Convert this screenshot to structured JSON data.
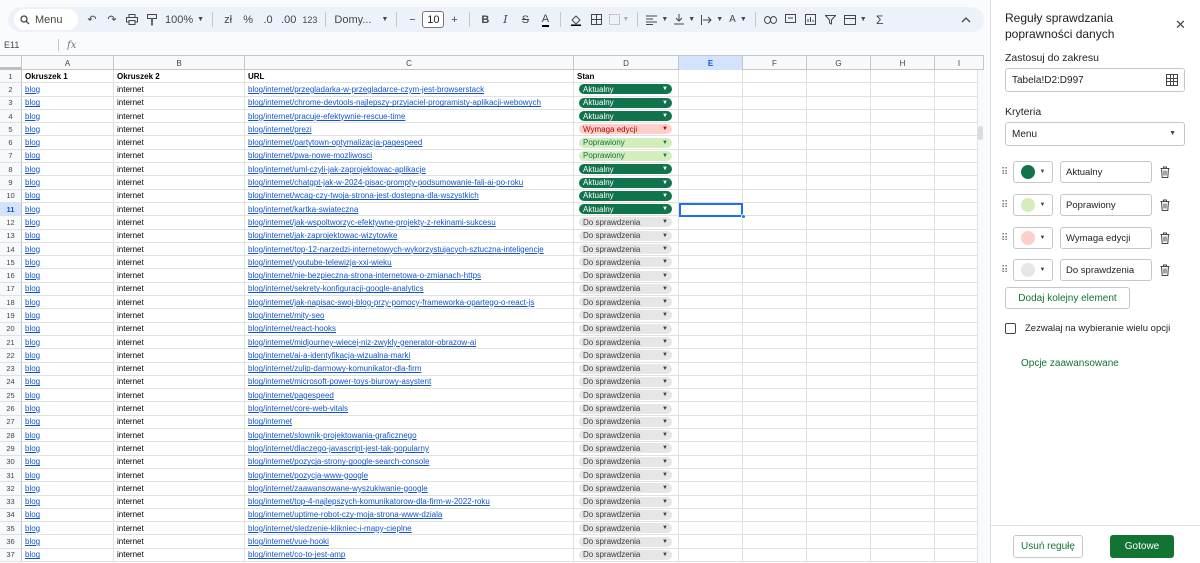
{
  "toolbar": {
    "search_label": "Menu",
    "zoom": "100%",
    "currency": "zł",
    "percent": "%",
    "dec_decrease": ".0",
    "dec_increase": ".00",
    "number_format": "123",
    "font": "Domy...",
    "font_size": "10",
    "minus": "−",
    "plus": "+"
  },
  "formula_bar": {
    "name_box": "E11",
    "fx": "fx",
    "value": ""
  },
  "columns": [
    "A",
    "B",
    "C",
    "D",
    "E",
    "F",
    "G",
    "H",
    "I"
  ],
  "header_row": {
    "a": "Okruszek 1",
    "b": "Okruszek 2",
    "c": "URL",
    "d": "Stan"
  },
  "status_colors": {
    "Aktualny": {
      "bg": "#11734b",
      "fg": "#ffffff"
    },
    "Poprawiony": {
      "bg": "#d4edbc",
      "fg": "#11734b"
    },
    "Wymaga edycji": {
      "bg": "#ffcfc9",
      "fg": "#b10202"
    },
    "Do sprawdzenia": {
      "bg": "#e6e6e6",
      "fg": "#3d3d3d"
    }
  },
  "rows": [
    {
      "num": "2",
      "a": "blog",
      "b": "internet",
      "c": "blog/internet/przegladarka-w-przegladarce-czym-jest-browserstack",
      "d": "Aktualny"
    },
    {
      "num": "3",
      "a": "blog",
      "b": "internet",
      "c": "blog/internet/chrome-devtools-najlepszy-przyjaciel-programisty-aplikacji-webowych",
      "d": "Aktualny"
    },
    {
      "num": "4",
      "a": "blog",
      "b": "internet",
      "c": "blog/internet/pracuje-efektywnie-rescue-time",
      "d": "Aktualny"
    },
    {
      "num": "5",
      "a": "blog",
      "b": "internet",
      "c": "blog/internet/prezi",
      "d": "Wymaga edycji"
    },
    {
      "num": "6",
      "a": "blog",
      "b": "internet",
      "c": "blog/internet/partytown-optymalizacja-pagespeed",
      "d": "Poprawiony"
    },
    {
      "num": "7",
      "a": "blog",
      "b": "internet",
      "c": "blog/internet/pwa-nowe-mozliwosci",
      "d": "Poprawiony"
    },
    {
      "num": "8",
      "a": "blog",
      "b": "internet",
      "c": "blog/internet/uml-czyli-jak-zaprojektowac-aplikacje",
      "d": "Aktualny"
    },
    {
      "num": "9",
      "a": "blog",
      "b": "internet",
      "c": "blog/internet/chatgpt-jak-w-2024-pisac-prompty-podsumowanie-fali-ai-po-roku",
      "d": "Aktualny"
    },
    {
      "num": "10",
      "a": "blog",
      "b": "internet",
      "c": "blog/internet/wcag-czy-twoja-strona-jest-dostepna-dla-wszystkich",
      "d": "Aktualny"
    },
    {
      "num": "11",
      "a": "blog",
      "b": "internet",
      "c": "blog/internet/kartka-swiateczna",
      "d": "Aktualny"
    },
    {
      "num": "12",
      "a": "blog",
      "b": "internet",
      "c": "blog/internet/jak-wspoltworzyc-efektywne-projekty-z-rekinami-sukcesu",
      "d": "Do sprawdzenia"
    },
    {
      "num": "13",
      "a": "blog",
      "b": "internet",
      "c": "blog/internet/jak-zaprojektowac-wizytowke",
      "d": "Do sprawdzenia"
    },
    {
      "num": "14",
      "a": "blog",
      "b": "internet",
      "c": "blog/internet/top-12-narzedzi-internetowych-wykorzystujacych-sztuczna-inteligencje",
      "d": "Do sprawdzenia"
    },
    {
      "num": "15",
      "a": "blog",
      "b": "internet",
      "c": "blog/internet/youtube-telewizja-xxi-wieku",
      "d": "Do sprawdzenia"
    },
    {
      "num": "16",
      "a": "blog",
      "b": "internet",
      "c": "blog/internet/nie-bezpieczna-strona-internetowa-o-zmianach-https",
      "d": "Do sprawdzenia"
    },
    {
      "num": "17",
      "a": "blog",
      "b": "internet",
      "c": "blog/internet/sekrety-konfiguracji-google-analytics",
      "d": "Do sprawdzenia"
    },
    {
      "num": "18",
      "a": "blog",
      "b": "internet",
      "c": "blog/internet/jak-napisac-swoj-blog-przy-pomocy-frameworka-opartego-o-react-js",
      "d": "Do sprawdzenia"
    },
    {
      "num": "19",
      "a": "blog",
      "b": "internet",
      "c": "blog/internet/mity-seo",
      "d": "Do sprawdzenia"
    },
    {
      "num": "20",
      "a": "blog",
      "b": "internet",
      "c": "blog/internet/react-hooks",
      "d": "Do sprawdzenia"
    },
    {
      "num": "21",
      "a": "blog",
      "b": "internet",
      "c": "blog/internet/midjourney-wiecej-niz-zwykly-generator-obrazow-ai",
      "d": "Do sprawdzenia"
    },
    {
      "num": "22",
      "a": "blog",
      "b": "internet",
      "c": "blog/internet/ai-a-identyfikacja-wizualna-marki",
      "d": "Do sprawdzenia"
    },
    {
      "num": "23",
      "a": "blog",
      "b": "internet",
      "c": "blog/internet/zulip-darmowy-komunikator-dla-firm",
      "d": "Do sprawdzenia"
    },
    {
      "num": "24",
      "a": "blog",
      "b": "internet",
      "c": "blog/internet/microsoft-power-toys-biurowy-asystent",
      "d": "Do sprawdzenia"
    },
    {
      "num": "25",
      "a": "blog",
      "b": "internet",
      "c": "blog/internet/pagespeed",
      "d": "Do sprawdzenia"
    },
    {
      "num": "26",
      "a": "blog",
      "b": "internet",
      "c": "blog/internet/core-web-vitals",
      "d": "Do sprawdzenia"
    },
    {
      "num": "27",
      "a": "blog",
      "b": "internet",
      "c": "blog/internet",
      "d": "Do sprawdzenia"
    },
    {
      "num": "28",
      "a": "blog",
      "b": "internet",
      "c": "blog/internet/slownik-projektowania-graficznego",
      "d": "Do sprawdzenia"
    },
    {
      "num": "29",
      "a": "blog",
      "b": "internet",
      "c": "blog/internet/dlaczego-javascript-jest-tak-popularny",
      "d": "Do sprawdzenia"
    },
    {
      "num": "30",
      "a": "blog",
      "b": "internet",
      "c": "blog/internet/pozycja-strony-google-search-console",
      "d": "Do sprawdzenia"
    },
    {
      "num": "31",
      "a": "blog",
      "b": "internet",
      "c": "blog/internet/pozycja-www-google",
      "d": "Do sprawdzenia"
    },
    {
      "num": "32",
      "a": "blog",
      "b": "internet",
      "c": "blog/internet/zaawansowane-wyszukiwanie-google",
      "d": "Do sprawdzenia"
    },
    {
      "num": "33",
      "a": "blog",
      "b": "internet",
      "c": "blog/internet/top-4-najlepszych-komunikatorow-dla-firm-w-2022-roku",
      "d": "Do sprawdzenia"
    },
    {
      "num": "34",
      "a": "blog",
      "b": "internet",
      "c": "blog/internet/uptime-robot-czy-moja-strona-www-dziala",
      "d": "Do sprawdzenia"
    },
    {
      "num": "35",
      "a": "blog",
      "b": "internet",
      "c": "blog/internet/sledzenie-klikniec-i-mapy-cieplne",
      "d": "Do sprawdzenia"
    },
    {
      "num": "36",
      "a": "blog",
      "b": "internet",
      "c": "blog/internet/vue-hooki",
      "d": "Do sprawdzenia"
    },
    {
      "num": "37",
      "a": "blog",
      "b": "internet",
      "c": "blog/internet/co-to-jest-amp",
      "d": "Do sprawdzenia"
    }
  ],
  "panel": {
    "title": "Reguły sprawdzania poprawności danych",
    "apply_label": "Zastosuj do zakresu",
    "range": "Tabela!D2:D997",
    "criteria_label": "Kryteria",
    "criteria": "Menu",
    "options": [
      {
        "label": "Aktualny",
        "color": "#11734b"
      },
      {
        "label": "Poprawiony",
        "color": "#d4edbc"
      },
      {
        "label": "Wymaga edycji",
        "color": "#ffcfc9"
      },
      {
        "label": "Do sprawdzenia",
        "color": "#e6e6e6"
      }
    ],
    "add_item": "Dodaj kolejny element",
    "multi_select": "Zezwalaj na wybieranie wielu opcji",
    "advanced": "Opcje zaawansowane",
    "remove_rule": "Usuń regułę",
    "done": "Gotowe"
  }
}
